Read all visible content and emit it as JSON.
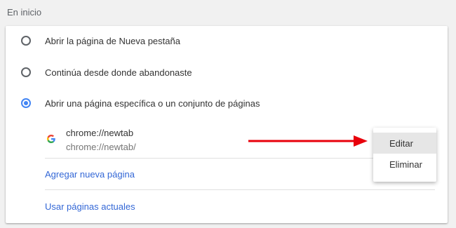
{
  "section": {
    "title": "En inicio"
  },
  "options": [
    {
      "label": "Abrir la página de Nueva pestaña",
      "checked": false
    },
    {
      "label": "Continúa desde donde abandonaste",
      "checked": false
    },
    {
      "label": "Abrir una página específica o un conjunto de páginas",
      "checked": true
    }
  ],
  "startup_page": {
    "icon": "google-g-icon",
    "title": "chrome://newtab",
    "url": "chrome://newtab/"
  },
  "links": {
    "add_page": "Agregar nueva página",
    "use_current": "Usar páginas actuales"
  },
  "context_menu": {
    "edit": "Editar",
    "remove": "Eliminar"
  },
  "colors": {
    "accent": "#4285f4",
    "link": "#3367d6",
    "annotation_arrow": "#e8000b"
  }
}
